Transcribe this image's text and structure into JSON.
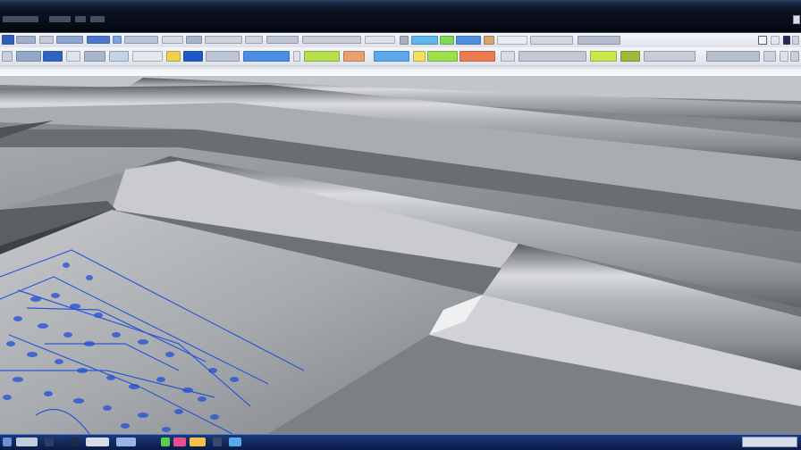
{
  "window": {
    "title": "",
    "icons": [
      "window-minimize-icon",
      "window-close-icon"
    ]
  },
  "toolbar": {
    "row1_labels": [],
    "row2_labels": []
  },
  "canvas": {
    "subject": "roof-panel-model",
    "colors": {
      "metal_dark": "#5e6166",
      "metal_mid": "#9a9da1",
      "metal_light": "#d9dbdd",
      "sketch_blue": "#1f4fd6"
    }
  },
  "taskbar": {
    "icons": [
      "start-icon",
      "app-icon",
      "app-icon",
      "app-icon",
      "app-icon",
      "app-icon",
      "app-icon",
      "app-icon"
    ],
    "clock": ""
  }
}
